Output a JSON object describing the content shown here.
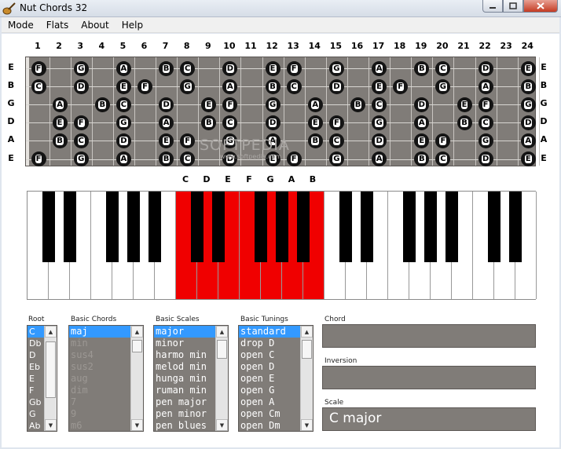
{
  "window": {
    "title": "Nut Chords 32"
  },
  "menu": [
    "Mode",
    "Flats",
    "About",
    "Help"
  ],
  "fret_numbers": [
    "1",
    "2",
    "3",
    "4",
    "5",
    "6",
    "7",
    "8",
    "9",
    "10",
    "11",
    "12",
    "13",
    "14",
    "15",
    "16",
    "17",
    "18",
    "19",
    "20",
    "21",
    "22",
    "23",
    "24"
  ],
  "strings": [
    "E",
    "B",
    "G",
    "D",
    "A",
    "E"
  ],
  "fretboard_notes": [
    {
      "string": 0,
      "fret": 0,
      "note": "F"
    },
    {
      "string": 0,
      "fret": 2,
      "note": "G"
    },
    {
      "string": 0,
      "fret": 4,
      "note": "A"
    },
    {
      "string": 0,
      "fret": 6,
      "note": "B"
    },
    {
      "string": 0,
      "fret": 7,
      "note": "C"
    },
    {
      "string": 0,
      "fret": 9,
      "note": "D"
    },
    {
      "string": 0,
      "fret": 11,
      "note": "E"
    },
    {
      "string": 0,
      "fret": 12,
      "note": "F"
    },
    {
      "string": 0,
      "fret": 14,
      "note": "G"
    },
    {
      "string": 0,
      "fret": 16,
      "note": "A"
    },
    {
      "string": 0,
      "fret": 18,
      "note": "B"
    },
    {
      "string": 0,
      "fret": 19,
      "note": "C"
    },
    {
      "string": 0,
      "fret": 21,
      "note": "D"
    },
    {
      "string": 0,
      "fret": 23,
      "note": "E"
    },
    {
      "string": 1,
      "fret": 0,
      "note": "C"
    },
    {
      "string": 1,
      "fret": 2,
      "note": "D"
    },
    {
      "string": 1,
      "fret": 4,
      "note": "E"
    },
    {
      "string": 1,
      "fret": 5,
      "note": "F"
    },
    {
      "string": 1,
      "fret": 7,
      "note": "G"
    },
    {
      "string": 1,
      "fret": 9,
      "note": "A"
    },
    {
      "string": 1,
      "fret": 11,
      "note": "B"
    },
    {
      "string": 1,
      "fret": 12,
      "note": "C"
    },
    {
      "string": 1,
      "fret": 14,
      "note": "D"
    },
    {
      "string": 1,
      "fret": 16,
      "note": "E"
    },
    {
      "string": 1,
      "fret": 17,
      "note": "F"
    },
    {
      "string": 1,
      "fret": 19,
      "note": "G"
    },
    {
      "string": 1,
      "fret": 21,
      "note": "A"
    },
    {
      "string": 1,
      "fret": 23,
      "note": "B"
    },
    {
      "string": 2,
      "fret": 1,
      "note": "A"
    },
    {
      "string": 2,
      "fret": 3,
      "note": "B"
    },
    {
      "string": 2,
      "fret": 4,
      "note": "C"
    },
    {
      "string": 2,
      "fret": 6,
      "note": "D"
    },
    {
      "string": 2,
      "fret": 8,
      "note": "E"
    },
    {
      "string": 2,
      "fret": 9,
      "note": "F"
    },
    {
      "string": 2,
      "fret": 11,
      "note": "G"
    },
    {
      "string": 2,
      "fret": 13,
      "note": "A"
    },
    {
      "string": 2,
      "fret": 15,
      "note": "B"
    },
    {
      "string": 2,
      "fret": 16,
      "note": "C"
    },
    {
      "string": 2,
      "fret": 18,
      "note": "D"
    },
    {
      "string": 2,
      "fret": 20,
      "note": "E"
    },
    {
      "string": 2,
      "fret": 21,
      "note": "F"
    },
    {
      "string": 2,
      "fret": 23,
      "note": "G"
    },
    {
      "string": 3,
      "fret": 1,
      "note": "E"
    },
    {
      "string": 3,
      "fret": 2,
      "note": "F"
    },
    {
      "string": 3,
      "fret": 4,
      "note": "G"
    },
    {
      "string": 3,
      "fret": 6,
      "note": "A"
    },
    {
      "string": 3,
      "fret": 8,
      "note": "B"
    },
    {
      "string": 3,
      "fret": 9,
      "note": "C"
    },
    {
      "string": 3,
      "fret": 11,
      "note": "D"
    },
    {
      "string": 3,
      "fret": 13,
      "note": "E"
    },
    {
      "string": 3,
      "fret": 14,
      "note": "F"
    },
    {
      "string": 3,
      "fret": 16,
      "note": "G"
    },
    {
      "string": 3,
      "fret": 18,
      "note": "A"
    },
    {
      "string": 3,
      "fret": 20,
      "note": "B"
    },
    {
      "string": 3,
      "fret": 21,
      "note": "C"
    },
    {
      "string": 3,
      "fret": 23,
      "note": "D"
    },
    {
      "string": 4,
      "fret": 1,
      "note": "B"
    },
    {
      "string": 4,
      "fret": 2,
      "note": "C"
    },
    {
      "string": 4,
      "fret": 4,
      "note": "D"
    },
    {
      "string": 4,
      "fret": 6,
      "note": "E"
    },
    {
      "string": 4,
      "fret": 7,
      "note": "F"
    },
    {
      "string": 4,
      "fret": 9,
      "note": "G"
    },
    {
      "string": 4,
      "fret": 11,
      "note": "A"
    },
    {
      "string": 4,
      "fret": 13,
      "note": "B"
    },
    {
      "string": 4,
      "fret": 14,
      "note": "C"
    },
    {
      "string": 4,
      "fret": 16,
      "note": "D"
    },
    {
      "string": 4,
      "fret": 18,
      "note": "E"
    },
    {
      "string": 4,
      "fret": 19,
      "note": "F"
    },
    {
      "string": 4,
      "fret": 21,
      "note": "G"
    },
    {
      "string": 4,
      "fret": 23,
      "note": "A"
    },
    {
      "string": 5,
      "fret": 0,
      "note": "F"
    },
    {
      "string": 5,
      "fret": 2,
      "note": "G"
    },
    {
      "string": 5,
      "fret": 4,
      "note": "A"
    },
    {
      "string": 5,
      "fret": 6,
      "note": "B"
    },
    {
      "string": 5,
      "fret": 7,
      "note": "C"
    },
    {
      "string": 5,
      "fret": 9,
      "note": "D"
    },
    {
      "string": 5,
      "fret": 11,
      "note": "E"
    },
    {
      "string": 5,
      "fret": 12,
      "note": "F"
    },
    {
      "string": 5,
      "fret": 14,
      "note": "G"
    },
    {
      "string": 5,
      "fret": 16,
      "note": "A"
    },
    {
      "string": 5,
      "fret": 18,
      "note": "B"
    },
    {
      "string": 5,
      "fret": 19,
      "note": "C"
    },
    {
      "string": 5,
      "fret": 21,
      "note": "D"
    },
    {
      "string": 5,
      "fret": 23,
      "note": "E"
    }
  ],
  "watermark": {
    "text": "SOFTPEDIA",
    "url": "www.softpedia.com"
  },
  "scale_notes": [
    "C",
    "D",
    "E",
    "F",
    "G",
    "A",
    "B"
  ],
  "keyboard": {
    "white_key_count": 24,
    "highlighted_white_keys": [
      7,
      8,
      9,
      10,
      11,
      12,
      13
    ],
    "highlight_color": "#f00000"
  },
  "panels": {
    "root": {
      "label": "Root",
      "items": [
        "C",
        "Db",
        "D",
        "Eb",
        "E",
        "F",
        "Gb",
        "G",
        "Ab"
      ],
      "selected": 0
    },
    "basic_chords": {
      "label": "Basic Chords",
      "items": [
        "maj",
        "min",
        "sus4",
        "sus2",
        "aug",
        "dim",
        "7",
        "9",
        "m6"
      ],
      "selected": 0
    },
    "basic_scales": {
      "label": "Basic Scales",
      "items": [
        "major",
        "minor",
        "harmo min",
        "melod min",
        "hunga min",
        "ruman min",
        "pen major",
        "pen minor",
        "pen blues"
      ],
      "selected": 0
    },
    "basic_tunings": {
      "label": "Basic Tunings",
      "items": [
        "standard",
        "drop D",
        "open C",
        "open D",
        "open E",
        "open G",
        "open A",
        "open Cm",
        "open Dm"
      ],
      "selected": 0
    }
  },
  "outputs": {
    "chord": {
      "label": "Chord",
      "value": ""
    },
    "inversion": {
      "label": "Inversion",
      "value": ""
    },
    "scale": {
      "label": "Scale",
      "value": "C major"
    }
  },
  "colors": {
    "selection": "#3399ff",
    "panel_bg": "#807c78",
    "note_dot": "#141414"
  }
}
